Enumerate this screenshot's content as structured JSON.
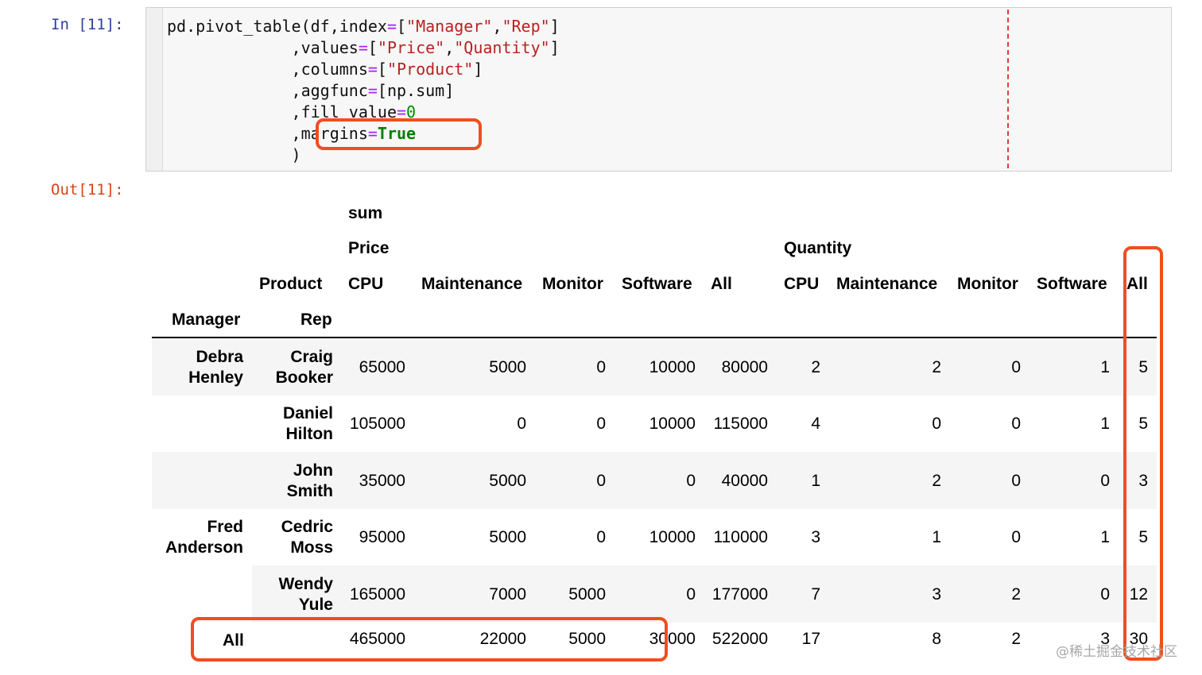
{
  "notebook": {
    "in_prompt": "In [11]:",
    "out_prompt": "Out[11]:"
  },
  "code": {
    "line1": {
      "a": "pd.pivot_table(df,index",
      "b": "=",
      "c": "[",
      "d": "\"Manager\"",
      "e": ",",
      "f": "\"Rep\"",
      "g": "]"
    },
    "line2": {
      "a": "             ,values",
      "b": "=",
      "c": "[",
      "d": "\"Price\"",
      "e": ",",
      "f": "\"Quantity\"",
      "g": "]"
    },
    "line3": {
      "a": "             ,columns",
      "b": "=",
      "c": "[",
      "d": "\"Product\"",
      "e": "]"
    },
    "line4": {
      "a": "             ,aggfunc",
      "b": "=",
      "c": "[np.sum]"
    },
    "line5": {
      "a": "             ,fill_value",
      "b": "=",
      "c": "0"
    },
    "line6": {
      "a": "             ,margins",
      "b": "=",
      "c": "True"
    },
    "line7": {
      "a": "             )"
    }
  },
  "table": {
    "header": {
      "sum": "sum",
      "price": "Price",
      "quantity": "Quantity",
      "product": "Product",
      "columns": [
        "CPU",
        "Maintenance",
        "Monitor",
        "Software",
        "All",
        "CPU",
        "Maintenance",
        "Monitor",
        "Software",
        "All"
      ],
      "manager": "Manager",
      "rep": "Rep"
    },
    "rows": [
      {
        "manager1": "Debra",
        "manager2": "Henley",
        "rep1": "Craig",
        "rep2": "Booker",
        "values": [
          "65000",
          "5000",
          "0",
          "10000",
          "80000",
          "2",
          "2",
          "0",
          "1",
          "5"
        ]
      },
      {
        "manager1": "",
        "manager2": "",
        "rep1": "Daniel",
        "rep2": "Hilton",
        "values": [
          "105000",
          "0",
          "0",
          "10000",
          "115000",
          "4",
          "0",
          "0",
          "1",
          "5"
        ]
      },
      {
        "manager1": "",
        "manager2": "",
        "rep1": "John",
        "rep2": "Smith",
        "values": [
          "35000",
          "5000",
          "0",
          "0",
          "40000",
          "1",
          "2",
          "0",
          "0",
          "3"
        ]
      },
      {
        "manager1": "Fred",
        "manager2": "Anderson",
        "rep1": "Cedric",
        "rep2": "Moss",
        "values": [
          "95000",
          "5000",
          "0",
          "10000",
          "110000",
          "3",
          "1",
          "0",
          "1",
          "5"
        ]
      },
      {
        "manager1": "",
        "manager2": "",
        "rep1": "Wendy",
        "rep2": "Yule",
        "values": [
          "165000",
          "7000",
          "5000",
          "0",
          "177000",
          "7",
          "3",
          "2",
          "0",
          "12"
        ]
      }
    ],
    "all_row": {
      "label": "All",
      "values": [
        "465000",
        "22000",
        "5000",
        "30000",
        "522000",
        "17",
        "8",
        "2",
        "3",
        "30"
      ]
    }
  },
  "watermark": "@稀土掘金技术社区",
  "colors": {
    "highlight": "#f04e1e",
    "in_prompt": "#303f9f",
    "out_prompt": "#d84315"
  }
}
